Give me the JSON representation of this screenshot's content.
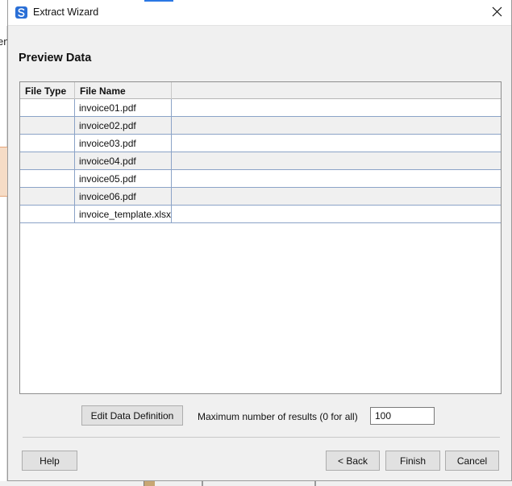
{
  "window": {
    "title": "Extract Wizard",
    "icon": "app-s-icon",
    "close_icon": "close-icon"
  },
  "background": {
    "peek_text": "en"
  },
  "page": {
    "heading": "Preview Data"
  },
  "grid": {
    "columns": [
      "File Type",
      "File Name",
      ""
    ],
    "rows": [
      {
        "file_type": "",
        "file_name": "invoice01.pdf"
      },
      {
        "file_type": "",
        "file_name": "invoice02.pdf"
      },
      {
        "file_type": "",
        "file_name": "invoice03.pdf"
      },
      {
        "file_type": "",
        "file_name": "invoice04.pdf"
      },
      {
        "file_type": "",
        "file_name": "invoice05.pdf"
      },
      {
        "file_type": "",
        "file_name": "invoice06.pdf"
      },
      {
        "file_type": "",
        "file_name": "invoice_template.xlsx"
      }
    ]
  },
  "controls": {
    "edit_definition_label": "Edit Data Definition",
    "max_results_label": "Maximum number of results (0 for all)",
    "max_results_value": "100"
  },
  "footer": {
    "help_label": "Help",
    "back_label": "< Back",
    "finish_label": "Finish",
    "cancel_label": "Cancel"
  },
  "colors": {
    "accent": "#2b78e4",
    "grid_line": "#8ba3c7",
    "dialog_bg": "#f0f0f0"
  }
}
